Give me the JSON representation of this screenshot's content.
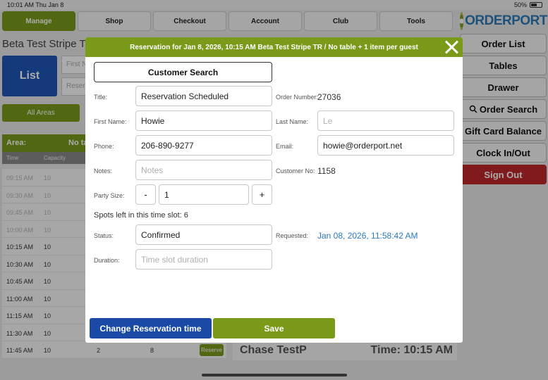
{
  "status": {
    "time": "10:01 AM   Thu Jan 8",
    "battery": "50%"
  },
  "nav": [
    "Manage",
    "Shop",
    "Checkout",
    "Account",
    "Club",
    "Tools"
  ],
  "logo": {
    "text": "ORDERPORT"
  },
  "side_menu": [
    "Order List",
    "Tables",
    "Drawer",
    "Order Search",
    "Gift Card Balance",
    "Clock In/Out",
    "Sign Out"
  ],
  "background": {
    "title": "Beta Test Stripe TR",
    "list_button": "List",
    "first_name_placeholder": "First N",
    "reservation_placeholder": "Reserv",
    "all_areas": "All Areas",
    "area_label": "Area:",
    "area_value": "No ta",
    "col_time": "Time",
    "col_capacity": "Capacity",
    "rows": [
      {
        "time": "09:15 AM",
        "cap": "10"
      },
      {
        "time": "09:30 AM",
        "cap": "10"
      },
      {
        "time": "09:45 AM",
        "cap": "10"
      },
      {
        "time": "10:00 AM",
        "cap": "10"
      },
      {
        "time": "10:15 AM",
        "cap": "10"
      },
      {
        "time": "10:30 AM",
        "cap": "10"
      },
      {
        "time": "10:45 AM",
        "cap": "10"
      },
      {
        "time": "11:00 AM",
        "cap": "10"
      },
      {
        "time": "11:15 AM",
        "cap": "10"
      },
      {
        "time": "11:30 AM",
        "cap": "10"
      },
      {
        "time": "11:45 AM",
        "cap": "10",
        "a": "2",
        "b": "8",
        "reserve": "Reserve"
      }
    ],
    "bottom_name": "Chase TestP",
    "bottom_time": "Time: 10:15 AM"
  },
  "modal": {
    "header": "Reservation for Jan 8, 2026, 10:15 AM Beta Test Stripe TR / No table + 1 item per guest",
    "customer_search": "Customer Search",
    "title_label": "Title:",
    "title_value": "Reservation Scheduled",
    "order_number_label": "Order Number:",
    "order_number": "27036",
    "first_name_label": "First Name:",
    "first_name": "Howie",
    "last_name_label": "Last Name:",
    "last_name_placeholder": "Le",
    "phone_label": "Phone:",
    "phone": "206-890-9277",
    "email_label": "Email:",
    "email": "howie@orderport.net",
    "notes_label": "Notes:",
    "notes_placeholder": "Notes",
    "customer_no_label": "Customer No:",
    "customer_no": "1158",
    "party_size_label": "Party Size:",
    "party_size": "1",
    "minus": "-",
    "plus": "+",
    "spots_left": "Spots left in this time slot: 6",
    "status_label": "Status:",
    "status": "Confirmed",
    "requested_label": "Requested:",
    "requested": "Jan 08, 2026, 11:58:42 AM",
    "duration_label": "Duration:",
    "duration_placeholder": "Time slot duration",
    "change_button": "Change Reservation time",
    "save_button": "Save"
  },
  "colors": {
    "accent_green": "#7a9a1a",
    "primary_blue": "#1a4aa6",
    "danger_red": "#c0282b",
    "link_blue": "#2a78c2"
  }
}
